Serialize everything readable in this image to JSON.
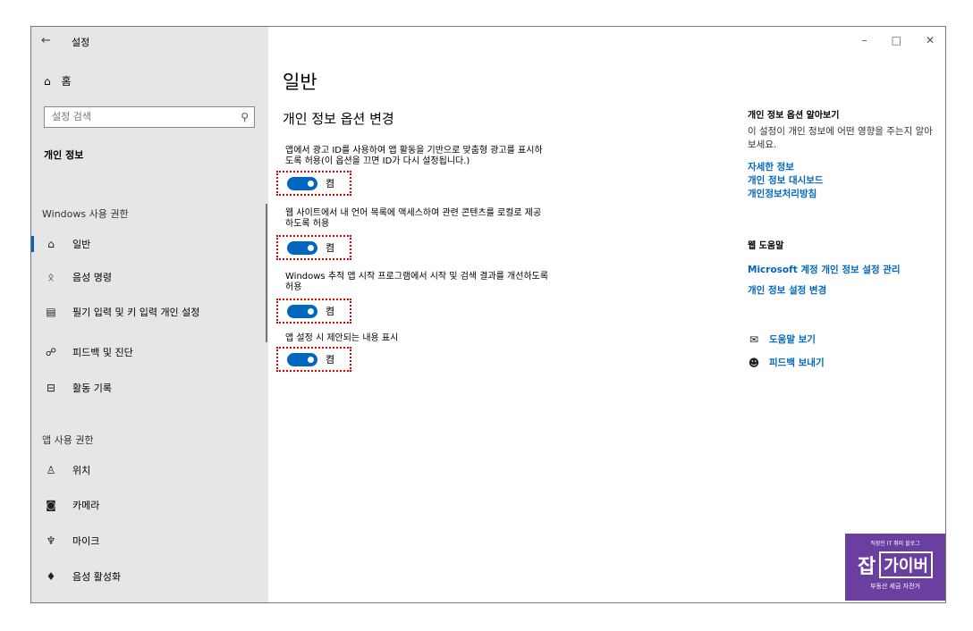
{
  "window": {
    "title": "설정",
    "back_glyph": "←",
    "controls": [
      "–",
      "□",
      "✕"
    ]
  },
  "sidebar": {
    "home_label": "홈",
    "search_placeholder": "설정 검색",
    "category": "개인 정보",
    "windows_section": "Windows 사용 권한",
    "windows_items": [
      {
        "label": "일반",
        "icon": "lock-icon",
        "glyph": "🔒"
      },
      {
        "label": "음성 명령",
        "icon": "speech-icon",
        "glyph": "ᛟ"
      },
      {
        "label": "필기 입력 및 키 입력 개인 설정",
        "icon": "notepad-icon",
        "glyph": "▤"
      },
      {
        "label": "피드백 및 진단",
        "icon": "feedback-icon",
        "glyph": "☍"
      },
      {
        "label": "활동 기록",
        "icon": "history-icon",
        "glyph": "⊟"
      }
    ],
    "app_section": "앱 사용 권한",
    "app_items": [
      {
        "label": "위치",
        "icon": "location-icon",
        "glyph": "♙"
      },
      {
        "label": "카메라",
        "icon": "camera-icon",
        "glyph": "◙"
      },
      {
        "label": "마이크",
        "icon": "microphone-icon",
        "glyph": "♆"
      },
      {
        "label": "음성 활성화",
        "icon": "voice-activation-icon",
        "glyph": "♦"
      }
    ]
  },
  "main": {
    "page_title": "일반",
    "section_title": "개인 정보 옵션 변경",
    "options": [
      {
        "line1": "앱에서 광고 ID를 사용하여 앱 활동을 기반으로 맞춤형 광고를 표시하",
        "line2": "도록 허용(이 옵션을 끄면 ID가 다시 설정됩니다.)",
        "state": "켬"
      },
      {
        "line1": "웹 사이트에서 내 언어 목록에 액세스하여 관련 콘텐츠를 로컬로 제공",
        "line2": "하도록 허용",
        "state": "켬"
      },
      {
        "line1": "Windows 추적 앱 시작 프로그램에서 시작 및 검색 결과를 개선하도록",
        "line2": "허용",
        "state": "켬"
      },
      {
        "line1": "앱 설정 시 제안되는 내용 표시",
        "line2": "",
        "state": "켬"
      }
    ]
  },
  "right_panel": {
    "learn_title": "개인 정보 옵션 알아보기",
    "learn_desc": "이 설정이 개인 정보에 어떤 영향을 주는지 알아보세요.",
    "learn_links": [
      "자세한 정보",
      "개인 정보 대시보드",
      "개인정보처리방침"
    ],
    "web_help_title": "웹 도움말",
    "web_help_links": [
      "Microsoft 계정 개인 정보 설정 관리",
      "개인 정보 설정 변경"
    ],
    "help_link": "도움말 보기",
    "feedback_link": "피드백 보내기"
  },
  "watermark": {
    "top": "직장인 IT 취미 블로그",
    "big1": "잡",
    "big2": "가이버",
    "bottom": "부동산 세금 자전거"
  },
  "colors": {
    "accent": "#0067c0",
    "sidebar_bg": "#e6e6e6",
    "highlight_border": "#e00000"
  }
}
